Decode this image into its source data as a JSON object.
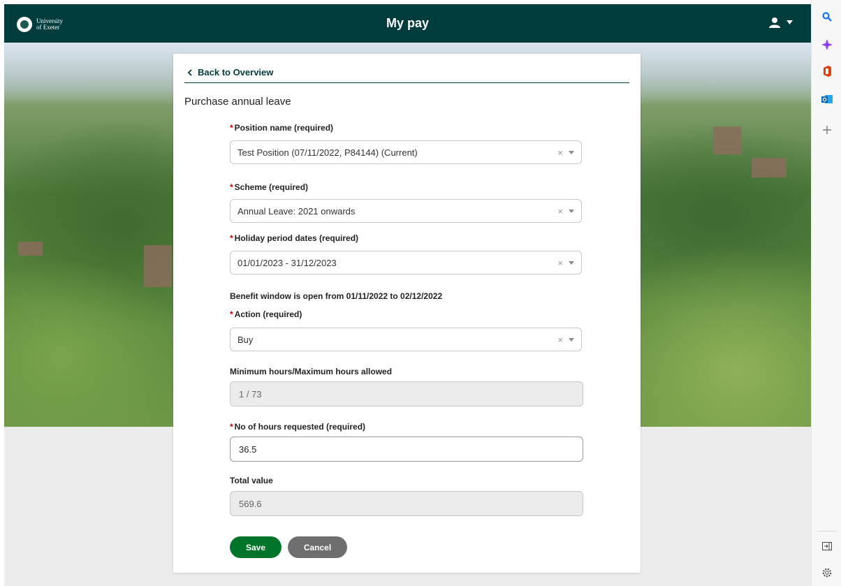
{
  "header": {
    "logo_line1": "University",
    "logo_line2": "of Exeter",
    "title": "My pay",
    "user_icon": "user-icon",
    "menu_icon": "caret-down-icon"
  },
  "browser_sidebar": {
    "icons": [
      "search-icon",
      "copilot-icon",
      "office-icon",
      "outlook-icon",
      "add-icon",
      "sidebar-toggle-icon",
      "settings-icon"
    ]
  },
  "form": {
    "back_label": "Back to Overview",
    "heading": "Purchase annual leave",
    "position": {
      "label": "Position name",
      "required": "(required)",
      "value": "Test Position (07/11/2022, P84144) (Current)"
    },
    "scheme": {
      "label": "Scheme",
      "required": "(required)",
      "value": "Annual Leave: 2021 onwards"
    },
    "holiday": {
      "label": "Holiday period dates",
      "required": "(required)",
      "value": "01/01/2023 - 31/12/2023"
    },
    "window_info": "Benefit window is open from 01/11/2022 to 02/12/2022",
    "action": {
      "label": "Action",
      "required": "(required)",
      "value": "Buy"
    },
    "min_max": {
      "label": "Minimum hours/Maximum hours allowed",
      "value": "1 / 73"
    },
    "hours": {
      "label": "No of hours requested",
      "required": "(required)",
      "value": "36.5"
    },
    "total": {
      "label": "Total value",
      "value": "569.6"
    },
    "save_label": "Save",
    "cancel_label": "Cancel",
    "clear_glyph": "×"
  },
  "colors": {
    "header_bg": "#003c3c",
    "save_bg": "#00752a",
    "cancel_bg": "#6e6e6e",
    "required": "#c00000"
  }
}
